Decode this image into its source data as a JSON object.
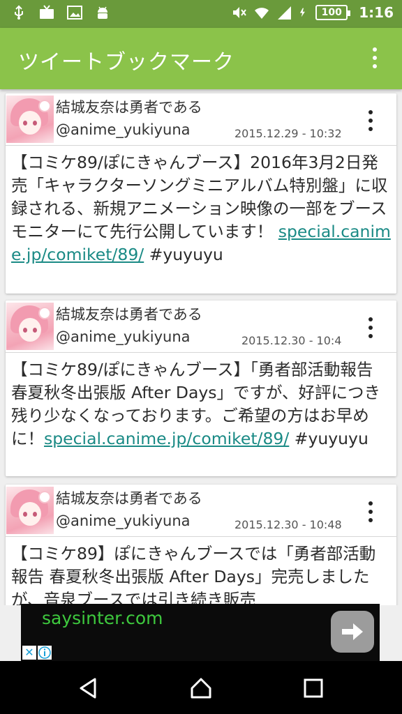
{
  "status_bar": {
    "battery": "100",
    "time": "1:16"
  },
  "app_bar": {
    "title": "ツイートブックマーク"
  },
  "tweets": [
    {
      "name": "結城友奈は勇者である",
      "handle": "@anime_yukiyuna",
      "date": "2015.12.29 - 10:32",
      "text_before": "【コミケ89/ぽにきゃんブース】2016年3月2日発売「キャラクターソングミニアルバム特別盤」に収録される、新規アニメーション映像の一部をブースモニターにて先行公開しています！ ",
      "link": "special.canime.jp/comiket/89/",
      "text_after": " #yuyuyu"
    },
    {
      "name": "結城友奈は勇者である",
      "handle": "@anime_yukiyuna",
      "date": "2015.12.30 - 10:4",
      "text_before": "【コミケ89/ぽにきゃんブース】「勇者部活動報告 春夏秋冬出張版 After Days」ですが、好評につき残り少なくなっております。ご希望の方はお早めに！",
      "link": "special.canime.jp/comiket/89/",
      "text_after": " #yuyuyu"
    },
    {
      "name": "結城友奈は勇者である",
      "handle": "@anime_yukiyuna",
      "date": "2015.12.30 - 10:48",
      "text_before": "【コミケ89】ぽにきゃんブースでは「勇者部活動報告 春夏秋冬出張版 After Days」完売しましたが、音泉ブースでは引き続き販売",
      "link": "",
      "text_after": ""
    }
  ],
  "ad": {
    "text": "saysinter.com"
  },
  "colors": {
    "app_bar": "#8bc34a",
    "status_bar": "#6a9a3b",
    "link": "#1a8a85"
  }
}
